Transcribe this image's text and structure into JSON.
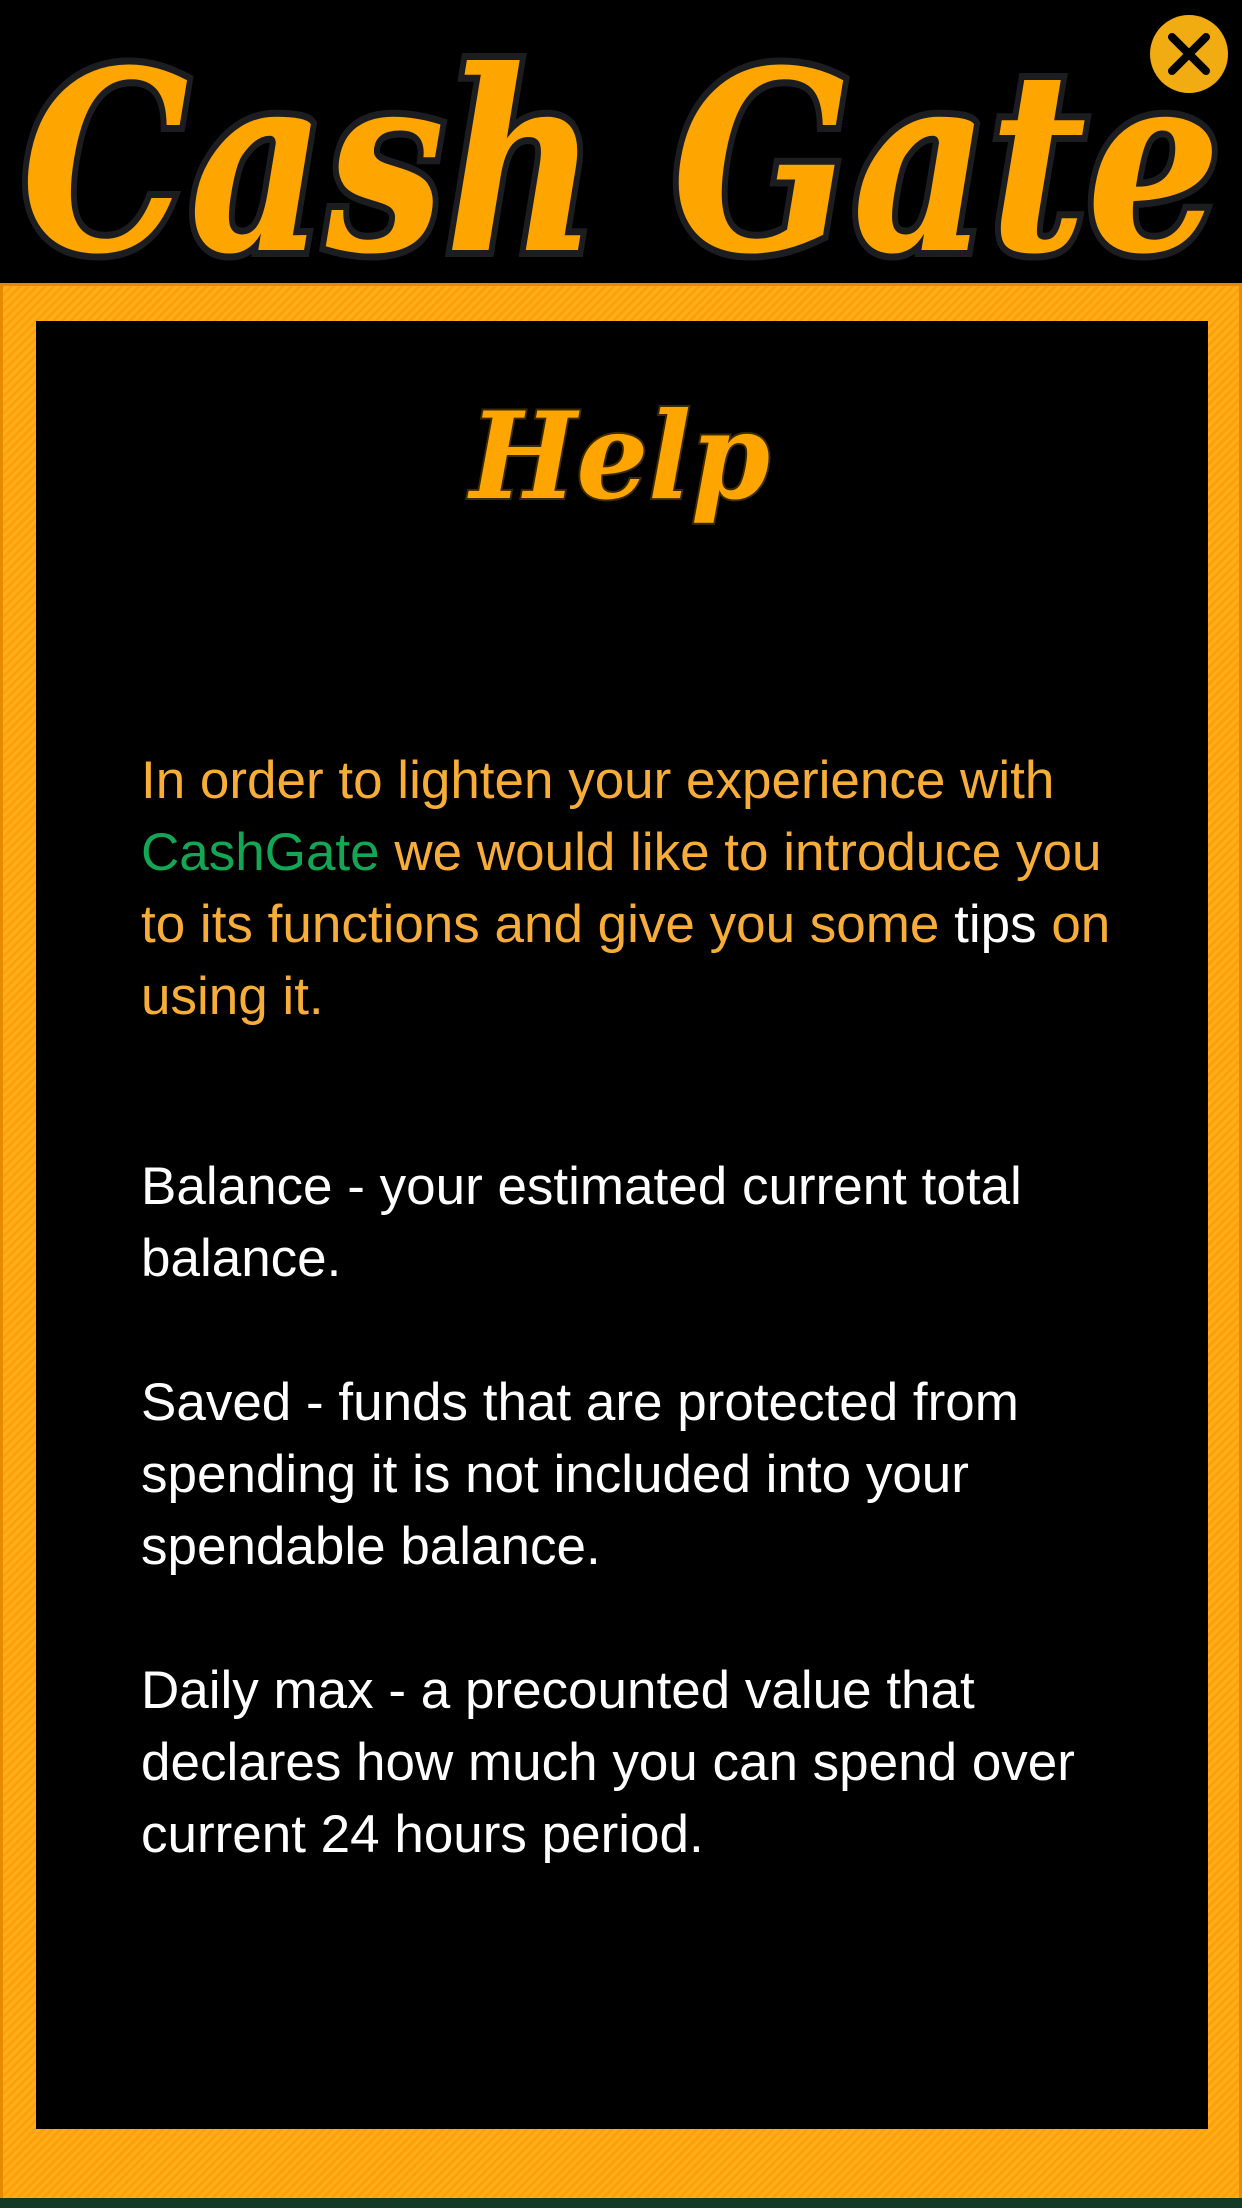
{
  "app": {
    "logo_text": "Cash Gate",
    "close_icon": "close-icon"
  },
  "colors": {
    "accent_orange": "#ffa500",
    "intro_text": "#f7ad38",
    "brand_green": "#13a654",
    "body_text": "#ffffff",
    "panel_bg": "#000000",
    "close_bg": "#f0ac11"
  },
  "help": {
    "title": "Help",
    "intro": {
      "part1": "In order to lighten your experience with ",
      "brand": "CashGate",
      "part2": " we would like to introduce you to its functions and give you some ",
      "tips": "tips",
      "part3": " on using it."
    },
    "items": [
      {
        "text": "Balance - your estimated current total balance."
      },
      {
        "text": "Saved - funds that are protected from spending it is not included into your spendable balance."
      },
      {
        "text": "Daily max - a precounted value that declares how much you can spend over current 24 hours period."
      }
    ]
  }
}
